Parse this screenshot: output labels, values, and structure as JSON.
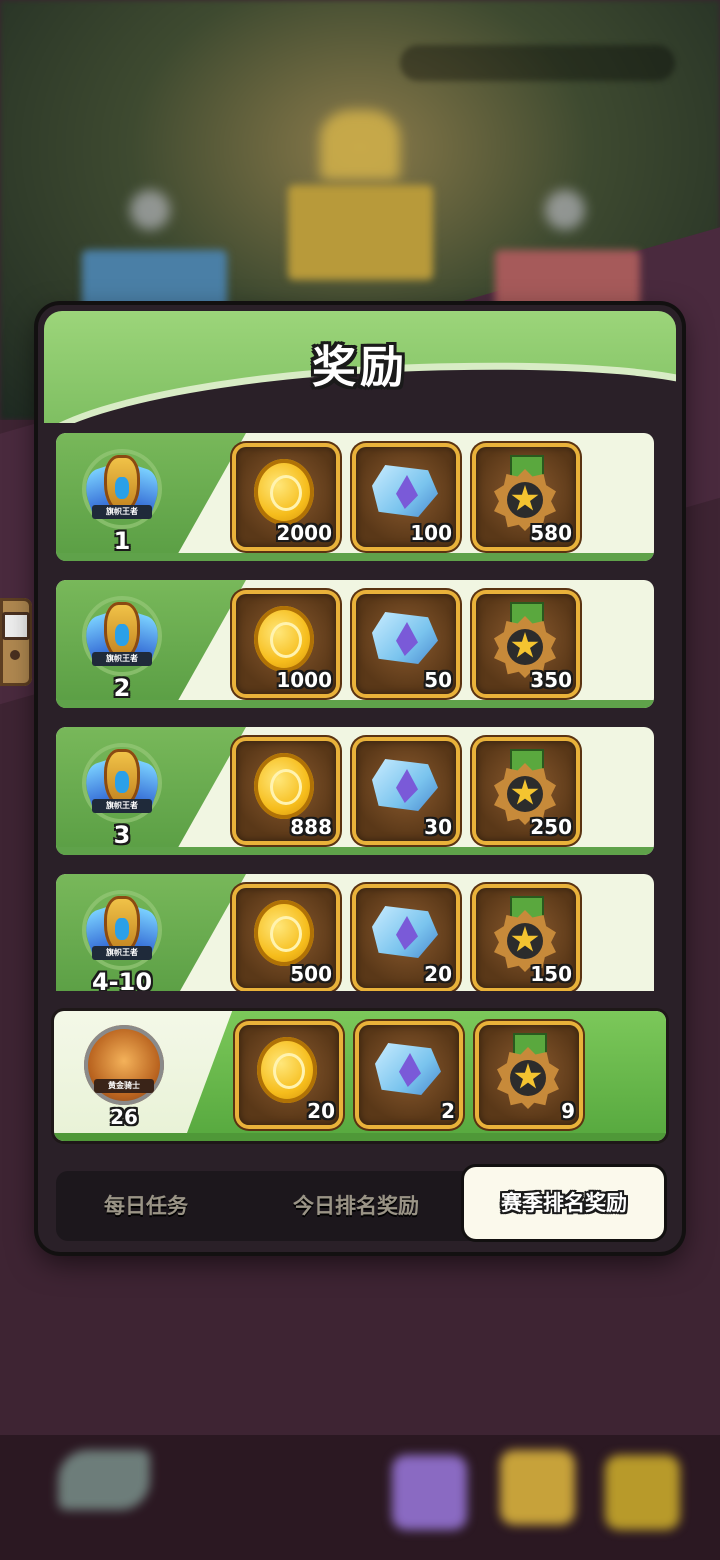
{
  "panel": {
    "title": "奖励"
  },
  "rewards": [
    {
      "rank": "1",
      "badge_label": "旗帜王者",
      "coins": "2000",
      "crystals": "100",
      "medals": "580"
    },
    {
      "rank": "2",
      "badge_label": "旗帜王者",
      "coins": "1000",
      "crystals": "50",
      "medals": "350"
    },
    {
      "rank": "3",
      "badge_label": "旗帜王者",
      "coins": "888",
      "crystals": "30",
      "medals": "250"
    },
    {
      "rank": "4-10",
      "badge_label": "旗帜王者",
      "coins": "500",
      "crystals": "20",
      "medals": "150"
    }
  ],
  "my_reward": {
    "rank": "26",
    "badge_label": "黄金骑士",
    "coins": "20",
    "crystals": "2",
    "medals": "9"
  },
  "tabs": [
    {
      "label": "每日任务",
      "active": false
    },
    {
      "label": "今日排名奖励",
      "active": false
    },
    {
      "label": "赛季排名奖励",
      "active": true
    }
  ],
  "icons": {
    "reward_1": "coin-icon",
    "reward_2": "crystal-icon",
    "reward_3": "medal-icon",
    "back": "back-arrow-icon"
  },
  "colors": {
    "accent_green": "#7cc85a",
    "panel_dark": "#2a2028",
    "gold_frame": "#e9b23a"
  }
}
